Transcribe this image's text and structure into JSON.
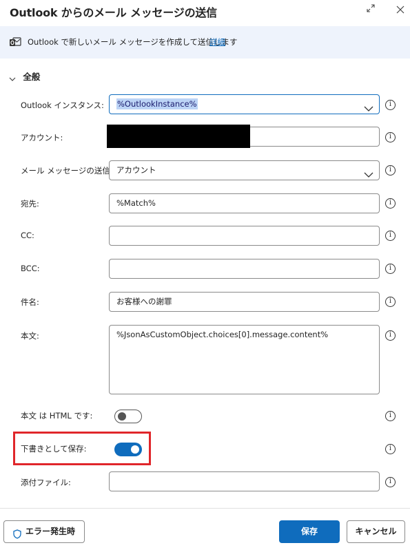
{
  "window": {
    "title": "Outlook からのメール メッセージの送信",
    "expand_icon": "expand-icon",
    "close_icon": "close-icon"
  },
  "info": {
    "description": "Outlook で新しいメール メッセージを作成して送信します",
    "link": "詳細"
  },
  "section": {
    "title": "全般"
  },
  "fields": {
    "instance": {
      "label": "Outlook インスタンス:",
      "value": "%OutlookInstance%"
    },
    "account": {
      "label": "アカウント:",
      "value": ""
    },
    "sender": {
      "label": "メール メッセージの送信元:",
      "value": "アカウント"
    },
    "to": {
      "label": "宛先:",
      "value": "%Match%"
    },
    "cc": {
      "label": "CC:",
      "value": ""
    },
    "bcc": {
      "label": "BCC:",
      "value": ""
    },
    "subject": {
      "label": "件名:",
      "value": "お客様への謝罪"
    },
    "body": {
      "label": "本文:",
      "value": "%JsonAsCustomObject.choices[0].message.content%"
    },
    "body_html": {
      "label": "本文 は HTML です:",
      "checked": false
    },
    "save_draft": {
      "label": "下書きとして保存:",
      "checked": true
    },
    "attachments": {
      "label": "添付ファイル:",
      "value": ""
    }
  },
  "info_icon": "i",
  "footer": {
    "on_error": "エラー発生時",
    "save": "保存",
    "cancel": "キャンセル"
  },
  "colors": {
    "accent": "#0f6cbd",
    "highlight": "#e0262a",
    "infobar_bg": "#eef3fc"
  }
}
